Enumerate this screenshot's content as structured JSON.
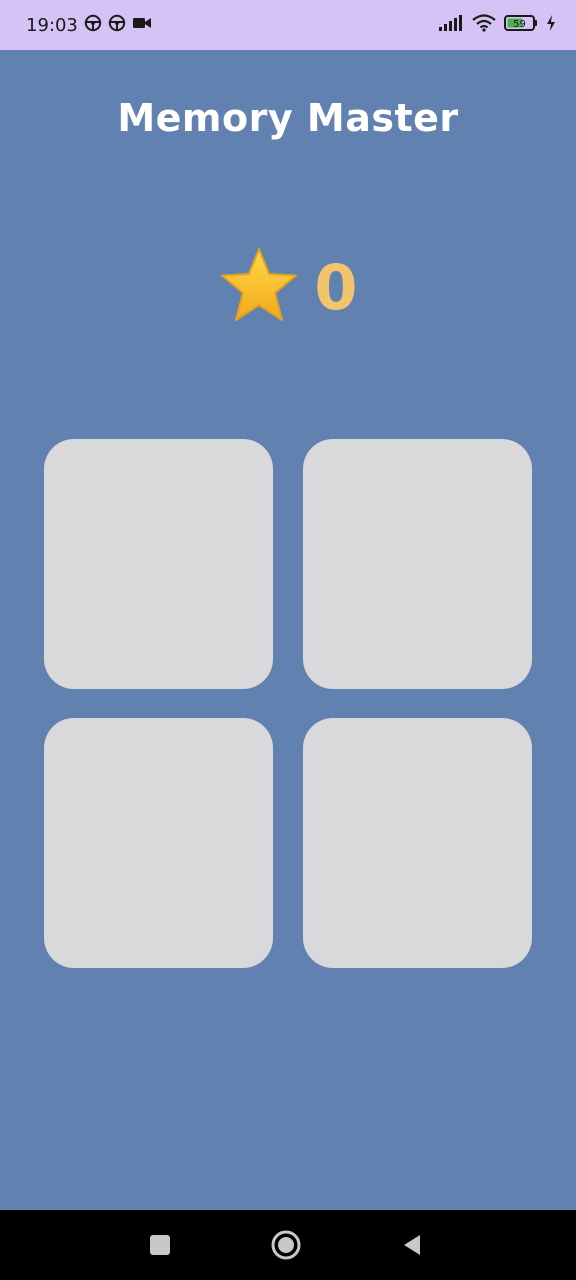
{
  "status_bar": {
    "time": "19:03",
    "battery_level": "59"
  },
  "app": {
    "title": "Memory Master",
    "score": "0",
    "cards_face_down": 4
  },
  "colors": {
    "background": "#6181b0",
    "status_bar": "#d4c3f4",
    "card": "#d9d9dc",
    "score": "#f2c56c",
    "star": "#f7bf2a"
  },
  "nav": {
    "icons": [
      "recents-icon",
      "home-icon",
      "back-icon"
    ]
  }
}
